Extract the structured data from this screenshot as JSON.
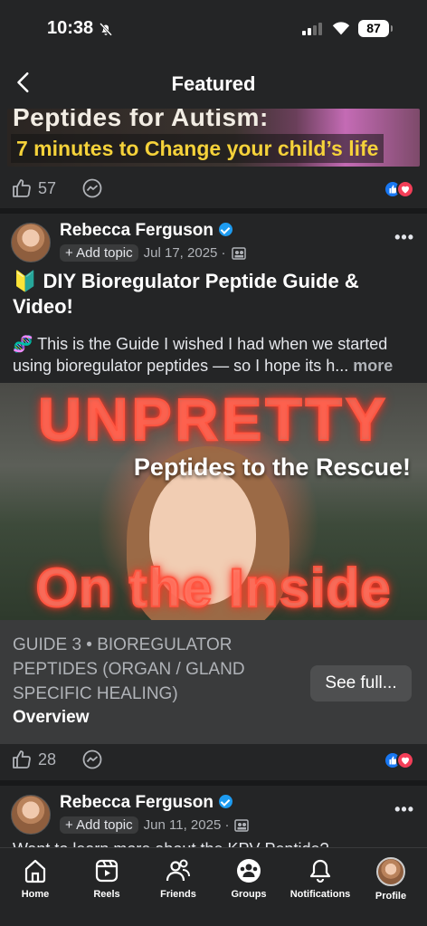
{
  "status_bar": {
    "time": "10:38",
    "battery": "87"
  },
  "header": {
    "title": "Featured"
  },
  "top_post": {
    "thumb_line_1": "Peptides for Autism:",
    "thumb_line_2": "7 minutes to Change your child’s life",
    "like_count": "57"
  },
  "post": {
    "author": "Rebecca Ferguson",
    "add_topic": "+ Add topic",
    "date": "Jul 17, 2025 ·",
    "title": "🔰 DIY Bioregulator Peptide Guide & Video!",
    "body": "🧬 This is the Guide I wished I had when we started using bioregulator peptides — so I hope its h...",
    "more": "more",
    "hero_line_1": "UNPRETTY",
    "hero_sub": "Peptides to the Rescue!",
    "hero_line_2": "On the Inside",
    "link_category": "GUIDE 3 • BIOREGULATOR PEPTIDES (ORGAN / GLAND SPECIFIC HEALING)",
    "link_title": "Overview",
    "see_full": "See full...",
    "like_count": "28"
  },
  "next_post": {
    "author": "Rebecca Ferguson",
    "add_topic": "+ Add topic",
    "date": "Jun 11, 2025 ·",
    "body_peek": "Want to learn more about the KPV Peptide?"
  },
  "bottom_nav": [
    {
      "label": "Home",
      "icon": "home-icon"
    },
    {
      "label": "Reels",
      "icon": "reels-icon"
    },
    {
      "label": "Friends",
      "icon": "friends-icon"
    },
    {
      "label": "Groups",
      "icon": "groups-icon"
    },
    {
      "label": "Notifications",
      "icon": "bell-icon"
    },
    {
      "label": "Profile",
      "icon": "avatar"
    }
  ],
  "colors": {
    "background": "#242526",
    "accent": "#1877f2",
    "love": "#f33e58",
    "verified": "#1d9bf0"
  }
}
